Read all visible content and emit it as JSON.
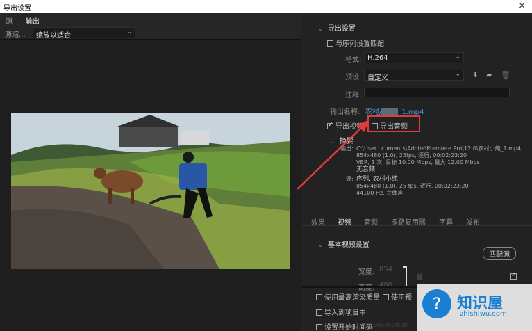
{
  "window": {
    "title": "导出设置",
    "close": "×"
  },
  "left_tabs": [
    "源",
    "输出"
  ],
  "source": {
    "label": "源缩...",
    "scaling": "缩放以适合"
  },
  "export": {
    "section_title": "导出设置",
    "match_sequence": "与序列设置匹配",
    "format_label": "格式:",
    "format_value": "H.264",
    "preset_label": "预设:",
    "preset_value": "自定义",
    "notes_label": "注释:",
    "output_name_label": "输出名称:",
    "output_name_prefix": "农村/",
    "output_name_suffix": "_1.mp4",
    "export_video": "导出视频",
    "export_audio": "导出音频"
  },
  "summary": {
    "title": "摘要",
    "output_label": "输出:",
    "output_lines": [
      "C:\\User...cuments\\Adobe\\Premiere Pro\\12.0\\农村小纯_1.mp4",
      "854x480 (1.0), 25fps, 逐行, 00:02:23:20",
      "VBR, 1 次, 目标 10.00 Mbps, 最大 12.00 Mbps",
      "无音频"
    ],
    "source_label": "源:",
    "source_lines": [
      "序列, 农村小纯",
      "854x480 (1.0), 25 fps, 逐行, 00:02:23:20",
      "44100 Hz, 立体声"
    ]
  },
  "right_tabs": [
    "效果",
    "视频",
    "音频",
    "多路复用器",
    "字幕",
    "发布"
  ],
  "basic_video": {
    "title": "基本视频设置",
    "match_source": "匹配源",
    "width_label": "宽度:",
    "width_value": "854",
    "height_label": "高度:",
    "height_value": "480"
  },
  "bottom": {
    "max_render": "使用最高渲染质量",
    "use_preview": "使用预",
    "import_project": "导入到项目中",
    "set_start_tc": "设置开始时间码",
    "tc_value": "00:00:00:00"
  },
  "watermark": {
    "name": "知识屋",
    "url": "zhishiwu.com"
  },
  "colors": {
    "accent": "#4b9ef0",
    "highlight": "#e23b3b"
  }
}
